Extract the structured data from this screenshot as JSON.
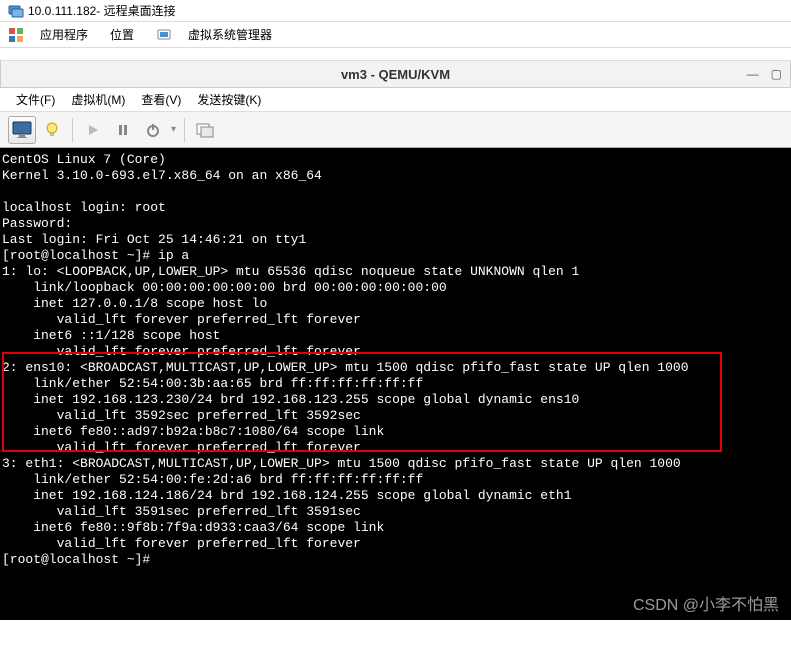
{
  "titlebar": {
    "ip": "10.0.111.182",
    "suffix": " - 远程桌面连接"
  },
  "host_menu": {
    "apps": "应用程序",
    "location": "位置",
    "vmm": "虚拟系统管理器"
  },
  "vm_window": {
    "title": "vm3 - QEMU/KVM",
    "minimize": "—",
    "maximize": "▢"
  },
  "vm_menu": {
    "file": "文件(F)",
    "vm": "虚拟机(M)",
    "view": "查看(V)",
    "send": "发送按键(K)"
  },
  "terminal_lines": [
    "CentOS Linux 7 (Core)",
    "Kernel 3.10.0-693.el7.x86_64 on an x86_64",
    "",
    "localhost login: root",
    "Password:",
    "Last login: Fri Oct 25 14:46:21 on tty1",
    "[root@localhost ~]# ip a",
    "1: lo: <LOOPBACK,UP,LOWER_UP> mtu 65536 qdisc noqueue state UNKNOWN qlen 1",
    "    link/loopback 00:00:00:00:00:00 brd 00:00:00:00:00:00",
    "    inet 127.0.0.1/8 scope host lo",
    "       valid_lft forever preferred_lft forever",
    "    inet6 ::1/128 scope host",
    "       valid_lft forever preferred_lft forever",
    "2: ens10: <BROADCAST,MULTICAST,UP,LOWER_UP> mtu 1500 qdisc pfifo_fast state UP qlen 1000",
    "    link/ether 52:54:00:3b:aa:65 brd ff:ff:ff:ff:ff:ff",
    "    inet 192.168.123.230/24 brd 192.168.123.255 scope global dynamic ens10",
    "       valid_lft 3592sec preferred_lft 3592sec",
    "    inet6 fe80::ad97:b92a:b8c7:1080/64 scope link",
    "       valid_lft forever preferred_lft forever",
    "3: eth1: <BROADCAST,MULTICAST,UP,LOWER_UP> mtu 1500 qdisc pfifo_fast state UP qlen 1000",
    "    link/ether 52:54:00:fe:2d:a6 brd ff:ff:ff:ff:ff:ff",
    "    inet 192.168.124.186/24 brd 192.168.124.255 scope global dynamic eth1",
    "       valid_lft 3591sec preferred_lft 3591sec",
    "    inet6 fe80::9f8b:7f9a:d933:caa3/64 scope link",
    "       valid_lft forever preferred_lft forever",
    "[root@localhost ~]#"
  ],
  "watermark": "CSDN @小李不怕黑"
}
